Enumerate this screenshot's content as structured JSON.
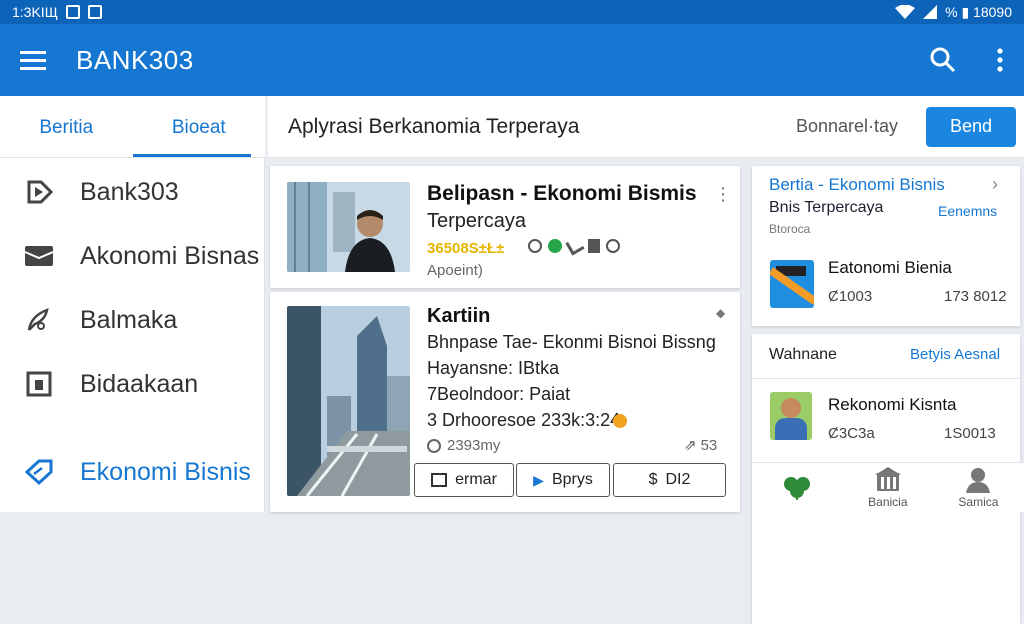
{
  "status": {
    "time": "1:3KIЩ",
    "right": "% ▮ 18090"
  },
  "app": {
    "title": "BANK303"
  },
  "tabs": [
    {
      "label": "Beritia"
    },
    {
      "label": "Bioeat"
    }
  ],
  "drawer": [
    {
      "label": "Bank303",
      "icon": "play-tag-icon"
    },
    {
      "label": "Akonomi Bisnas",
      "icon": "mail-icon"
    },
    {
      "label": "Balmaka",
      "icon": "feather-icon"
    },
    {
      "label": "Bidaakaan",
      "icon": "square-icon"
    },
    {
      "label": "Ekonomi Bisnis",
      "icon": "tag-icon"
    }
  ],
  "topbar": {
    "heading": "Aplyrasi Berkanomia Terperaya",
    "sub": "Bonnarel·tay",
    "button": "Bend"
  },
  "card1": {
    "title1": "Belipasn - Ekonomi Bismis",
    "title2": "Terpercaya",
    "price": "36508S±Ł±",
    "author": "Apoeint)"
  },
  "card2": {
    "title": "Kartiin",
    "line1": "Bhnpase Tae- Ekonmi Bisnoi Bissng",
    "line2": "Hayansne: IBtka",
    "line3": "7Beolndoor: Paiat",
    "line4": "3 Drhooresoe 233k:3:24",
    "views": "2393my",
    "likes": "53",
    "actions": [
      {
        "label": "ermar"
      },
      {
        "label": "Bprys"
      },
      {
        "label": "DI2"
      }
    ]
  },
  "side1": {
    "title": "Bertia - Ekonomi Bisnis",
    "sub": "Bnis Terpercaya",
    "link": "Eenemns",
    "small": "Btoroca",
    "item": {
      "name": "Eatonomi Bienia",
      "code": "Ȼ1003",
      "date": "173 8012"
    }
  },
  "side2": {
    "left": "Wahnane",
    "right": "Betyis Aesnal",
    "item": {
      "name": "Rekonomi Kisnta",
      "code": "Ȼ3C3a",
      "date": "1S0013"
    }
  },
  "bottomnav": [
    {
      "label": ""
    },
    {
      "label": "Banicia"
    },
    {
      "label": "Samica"
    }
  ],
  "colors": {
    "primary": "#1677d2",
    "statusbar": "#0d63b8",
    "price": "#e7b400"
  }
}
